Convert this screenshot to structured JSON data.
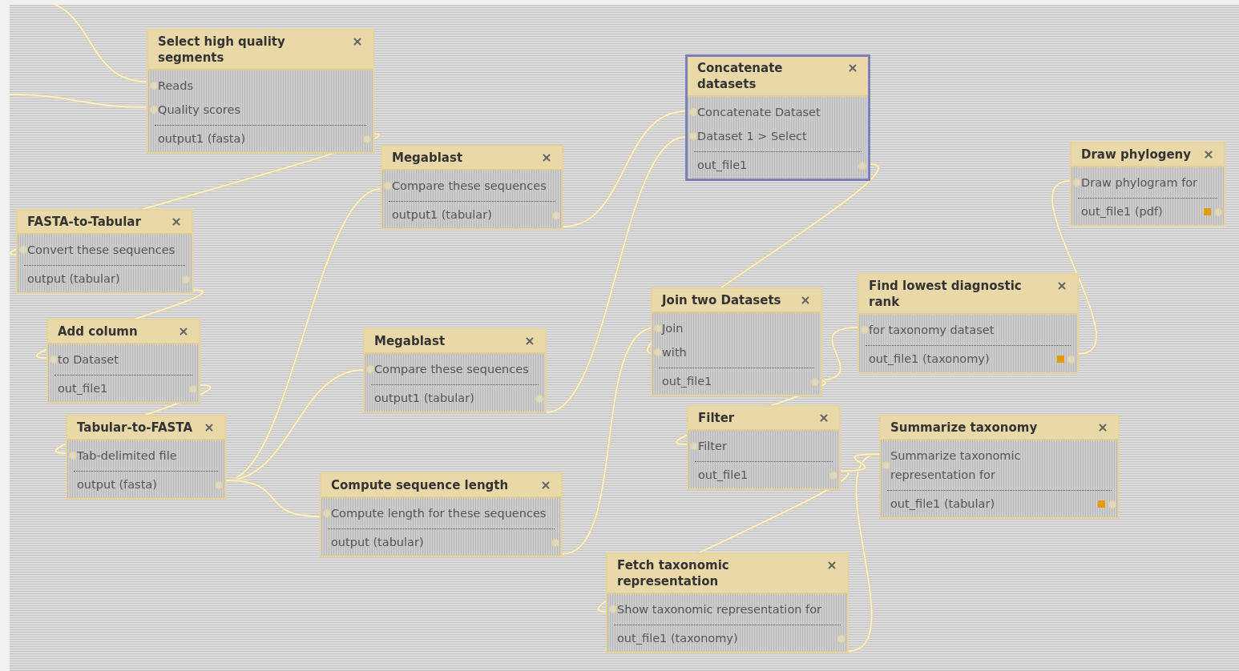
{
  "nodes": [
    {
      "title": "Select high quality segments",
      "selected": false,
      "inputs": [
        "Reads",
        "Quality scores"
      ],
      "outputs": [
        {
          "label": "output1 (fasta)",
          "marked": false
        }
      ]
    },
    {
      "title": "FASTA-to-Tabular",
      "selected": false,
      "inputs": [
        "Convert these sequences"
      ],
      "outputs": [
        {
          "label": "output (tabular)",
          "marked": false
        }
      ]
    },
    {
      "title": "Add column",
      "selected": false,
      "inputs": [
        "to Dataset"
      ],
      "outputs": [
        {
          "label": "out_file1",
          "marked": false
        }
      ]
    },
    {
      "title": "Tabular-to-FASTA",
      "selected": false,
      "inputs": [
        "Tab-delimited file"
      ],
      "outputs": [
        {
          "label": "output (fasta)",
          "marked": false
        }
      ]
    },
    {
      "title": "Megablast",
      "selected": false,
      "inputs": [
        "Compare these sequences"
      ],
      "outputs": [
        {
          "label": "output1 (tabular)",
          "marked": false
        }
      ]
    },
    {
      "title": "Megablast",
      "selected": false,
      "inputs": [
        "Compare these sequences"
      ],
      "outputs": [
        {
          "label": "output1 (tabular)",
          "marked": false
        }
      ]
    },
    {
      "title": "Compute sequence length",
      "selected": false,
      "inputs": [
        "Compute length for these sequences"
      ],
      "outputs": [
        {
          "label": "output (tabular)",
          "marked": false
        }
      ]
    },
    {
      "title": "Concatenate datasets",
      "selected": true,
      "inputs": [
        "Concatenate Dataset",
        "Dataset 1 > Select"
      ],
      "outputs": [
        {
          "label": "out_file1",
          "marked": false
        }
      ]
    },
    {
      "title": "Join two Datasets",
      "selected": false,
      "inputs": [
        "Join",
        "with"
      ],
      "outputs": [
        {
          "label": "out_file1",
          "marked": false
        }
      ]
    },
    {
      "title": "Filter",
      "selected": false,
      "inputs": [
        "Filter"
      ],
      "outputs": [
        {
          "label": "out_file1",
          "marked": false
        }
      ]
    },
    {
      "title": "Fetch taxonomic representation",
      "selected": false,
      "inputs": [
        "Show taxonomic representation for"
      ],
      "outputs": [
        {
          "label": "out_file1 (taxonomy)",
          "marked": false
        }
      ]
    },
    {
      "title": "Find lowest diagnostic rank",
      "selected": false,
      "inputs": [
        "for taxonomy dataset"
      ],
      "outputs": [
        {
          "label": "out_file1 (taxonomy)",
          "marked": true
        }
      ]
    },
    {
      "title": "Summarize taxonomy",
      "selected": false,
      "inputs": [
        "Summarize taxonomic representation for"
      ],
      "outputs": [
        {
          "label": "out_file1 (tabular)",
          "marked": true
        }
      ]
    },
    {
      "title": "Draw phylogeny",
      "selected": false,
      "inputs": [
        "Draw phylogram for"
      ],
      "outputs": [
        {
          "label": "out_file1 (pdf)",
          "marked": true
        }
      ]
    }
  ]
}
